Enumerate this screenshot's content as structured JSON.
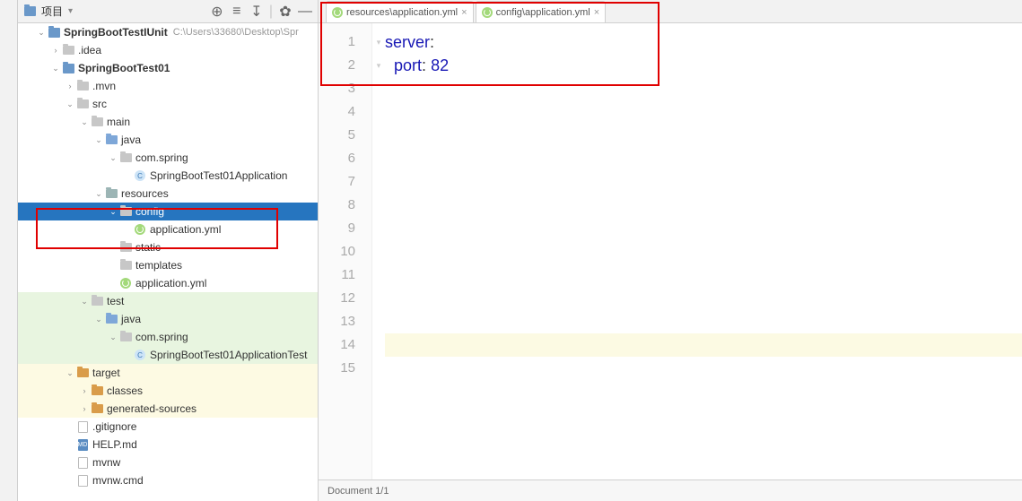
{
  "project_panel": {
    "title": "项目",
    "root_name": "SpringBootTestIUnit",
    "root_path": "C:\\Users\\33680\\Desktop\\Spr",
    "tree": [
      {
        "label": "SpringBootTestIUnit",
        "icon": "proj",
        "depth": 0,
        "chev": "down",
        "bold": true,
        "extra": "C:\\Users\\33680\\Desktop\\Spr"
      },
      {
        "label": ".idea",
        "icon": "folder-grey",
        "depth": 1,
        "chev": "right"
      },
      {
        "label": "SpringBootTest01",
        "icon": "proj",
        "depth": 1,
        "chev": "down",
        "bold": true
      },
      {
        "label": ".mvn",
        "icon": "folder-grey",
        "depth": 2,
        "chev": "right"
      },
      {
        "label": "src",
        "icon": "folder-grey",
        "depth": 2,
        "chev": "down"
      },
      {
        "label": "main",
        "icon": "folder-grey",
        "depth": 3,
        "chev": "down"
      },
      {
        "label": "java",
        "icon": "folder-blue",
        "depth": 4,
        "chev": "down"
      },
      {
        "label": "com.spring",
        "icon": "folder-grey",
        "depth": 5,
        "chev": "down"
      },
      {
        "label": "SpringBootTest01Application",
        "icon": "class",
        "depth": 6,
        "chev": ""
      },
      {
        "label": "resources",
        "icon": "folder-teal",
        "depth": 4,
        "chev": "down"
      },
      {
        "label": "config",
        "icon": "folder-grey",
        "depth": 5,
        "chev": "down",
        "selected": true
      },
      {
        "label": "application.yml",
        "icon": "yml",
        "depth": 6,
        "chev": ""
      },
      {
        "label": "static",
        "icon": "folder-grey",
        "depth": 5,
        "chev": ""
      },
      {
        "label": "templates",
        "icon": "folder-grey",
        "depth": 5,
        "chev": ""
      },
      {
        "label": "application.yml",
        "icon": "yml",
        "depth": 5,
        "chev": ""
      },
      {
        "label": "test",
        "icon": "folder-grey",
        "depth": 3,
        "chev": "down",
        "hl": "green"
      },
      {
        "label": "java",
        "icon": "folder-blue",
        "depth": 4,
        "chev": "down",
        "hl": "green"
      },
      {
        "label": "com.spring",
        "icon": "folder-grey",
        "depth": 5,
        "chev": "down",
        "hl": "green"
      },
      {
        "label": "SpringBootTest01ApplicationTest",
        "icon": "class",
        "depth": 6,
        "chev": "",
        "hl": "green"
      },
      {
        "label": "target",
        "icon": "folder-orange",
        "depth": 2,
        "chev": "down",
        "hl": "yellow"
      },
      {
        "label": "classes",
        "icon": "folder-orange",
        "depth": 3,
        "chev": "right",
        "hl": "yellow"
      },
      {
        "label": "generated-sources",
        "icon": "folder-orange",
        "depth": 3,
        "chev": "right",
        "hl": "yellow"
      },
      {
        "label": ".gitignore",
        "icon": "file",
        "depth": 2,
        "chev": ""
      },
      {
        "label": "HELP.md",
        "icon": "md",
        "depth": 2,
        "chev": ""
      },
      {
        "label": "mvnw",
        "icon": "file",
        "depth": 2,
        "chev": ""
      },
      {
        "label": "mvnw.cmd",
        "icon": "file",
        "depth": 2,
        "chev": ""
      }
    ]
  },
  "tabs": [
    {
      "label": "resources\\application.yml",
      "icon": "yml"
    },
    {
      "label": "config\\application.yml",
      "icon": "yml",
      "active": true
    }
  ],
  "editor": {
    "lines_total": 15,
    "current_line": 14,
    "code": {
      "line1_key": "server",
      "line2_key": "port",
      "line2_val": "82"
    }
  },
  "status": {
    "text": "Document 1/1"
  },
  "chart_data": {
    "type": "table",
    "note": "File content shown in editor as key-value YAML",
    "rows": [
      {
        "path": "server.port",
        "value": 82
      }
    ]
  }
}
